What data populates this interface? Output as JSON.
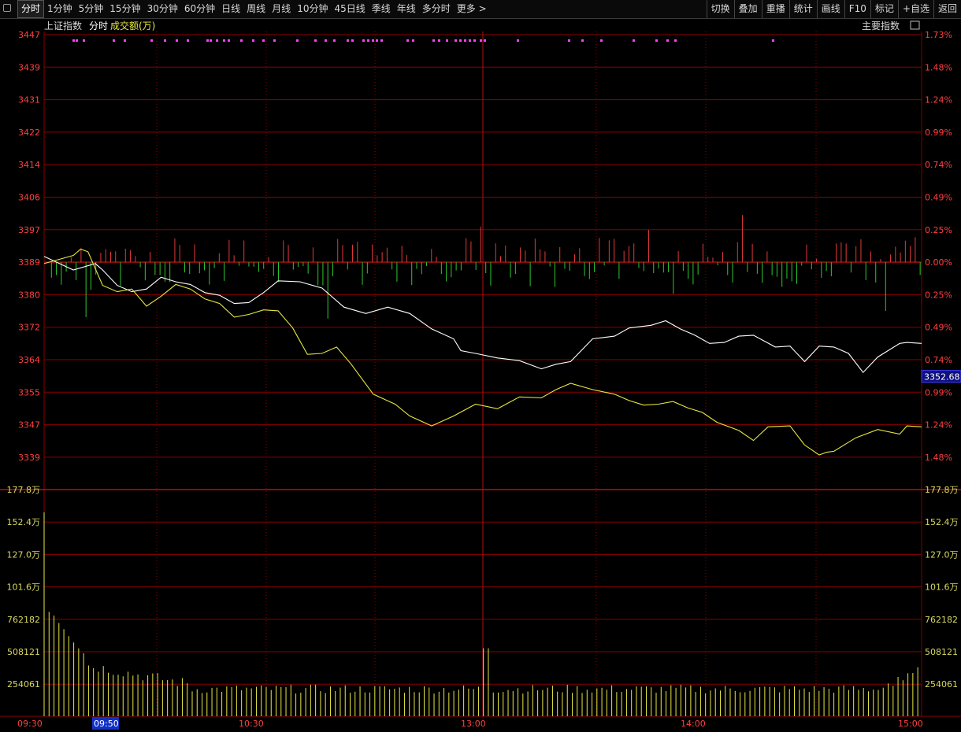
{
  "toolbar": {
    "periods": [
      "分时",
      "1分钟",
      "5分钟",
      "15分钟",
      "30分钟",
      "60分钟",
      "日线",
      "周线",
      "月线",
      "10分钟",
      "45日线",
      "季线",
      "年线",
      "多分时",
      "更多 >"
    ],
    "tools": [
      "切换",
      "叠加",
      "重播",
      "统计",
      "画线",
      "F10",
      "标记",
      "+自选",
      "返回"
    ]
  },
  "header": {
    "index_name": "上证指数",
    "mode": "分时",
    "volume_label": "成交额(万)",
    "indicator_label": "主要指数"
  },
  "price_axis": {
    "left": [
      "3447",
      "3439",
      "3431",
      "3422",
      "3414",
      "3406",
      "3397",
      "3389",
      "3380",
      "3372",
      "3364",
      "3355",
      "3347",
      "3339"
    ],
    "right": [
      "1.73%",
      "1.48%",
      "1.24%",
      "0.99%",
      "0.74%",
      "0.49%",
      "0.25%",
      "0.00%",
      "0.25%",
      "0.49%",
      "0.74%",
      "0.99%",
      "1.24%",
      "1.48%"
    ],
    "current_price": "3352.68"
  },
  "volume_axis": {
    "labels": [
      "177.8万",
      "152.4万",
      "127.0万",
      "101.6万",
      "762182",
      "508121",
      "254061"
    ]
  },
  "time_axis": {
    "labels": [
      "09:30",
      "09:50",
      "10:30",
      "13:00",
      "14:00",
      "15:00"
    ],
    "cursor_label": "09:50"
  },
  "colors": {
    "up": "#e03a3a",
    "down": "#2ec82e",
    "white_line": "#ffffff",
    "yellow_line": "#e8e840",
    "grid": "#8b0000",
    "axis_text": "#ff4040",
    "volume_text": "#d8d860",
    "magenta_marker": "#ff40ff",
    "cursor_box": "#1030c8"
  },
  "chart_data": {
    "type": "line",
    "prev_close": 3389,
    "y_range": [
      3330.5,
      3447
    ],
    "series": [
      {
        "name": "",
        "color": "white",
        "t": [
          0,
          8,
          14,
          16,
          20,
          24,
          28,
          32,
          36,
          40,
          44,
          48,
          52,
          56,
          60,
          64,
          70,
          76,
          82,
          88,
          94,
          100,
          106,
          112,
          114,
          118,
          124,
          130,
          136,
          140,
          144,
          150,
          156,
          160,
          166,
          170,
          174,
          178,
          182,
          186,
          190,
          194,
          200,
          204,
          208,
          212,
          216,
          220,
          224,
          228,
          234,
          236,
          240
        ],
        "v": [
          3386,
          3382,
          3384,
          3382,
          3378,
          3376,
          3377,
          3380,
          3379,
          3378,
          3376,
          3375,
          3373,
          3373,
          3376,
          3379,
          3379,
          3377,
          3372,
          3370,
          3372,
          3370,
          3366,
          3363,
          3360,
          3359,
          3358,
          3357,
          3355,
          3356,
          3357,
          3363,
          3364,
          3366,
          3367,
          3368,
          3366,
          3364,
          3362,
          3362,
          3364,
          3364,
          3361,
          3361,
          3357,
          3361,
          3361,
          3359,
          3354,
          3358,
          3362,
          3362,
          3362
        ]
      },
      {
        "name": "",
        "color": "yellow",
        "t": [
          0,
          8,
          10,
          12,
          16,
          20,
          24,
          28,
          32,
          36,
          40,
          44,
          48,
          52,
          56,
          60,
          64,
          68,
          72,
          76,
          80,
          84,
          90,
          96,
          100,
          106,
          112,
          118,
          124,
          130,
          136,
          140,
          144,
          150,
          156,
          160,
          164,
          168,
          172,
          176,
          180,
          184,
          190,
          194,
          198,
          204,
          208,
          212,
          214,
          216,
          222,
          228,
          234,
          236,
          240
        ],
        "v": [
          3384,
          3386,
          3388,
          3387,
          3378,
          3376,
          3377,
          3372,
          3375,
          3378,
          3377,
          3374,
          3373,
          3369,
          3370,
          3371,
          3371,
          3366,
          3359,
          3359,
          3361,
          3356,
          3348,
          3345,
          3342,
          3339,
          3342,
          3345,
          3344,
          3347,
          3347,
          3349,
          3351,
          3349,
          3348,
          3346,
          3345,
          3345,
          3346,
          3344,
          3343,
          3340,
          3338,
          3335,
          3339,
          3339,
          3334,
          3331,
          3332,
          3332,
          3336,
          3338,
          3337,
          3339,
          3339
        ]
      }
    ],
    "volume_max": 1778000,
    "volume_axis_range": [
      0,
      1778000
    ],
    "has_grid": true
  }
}
